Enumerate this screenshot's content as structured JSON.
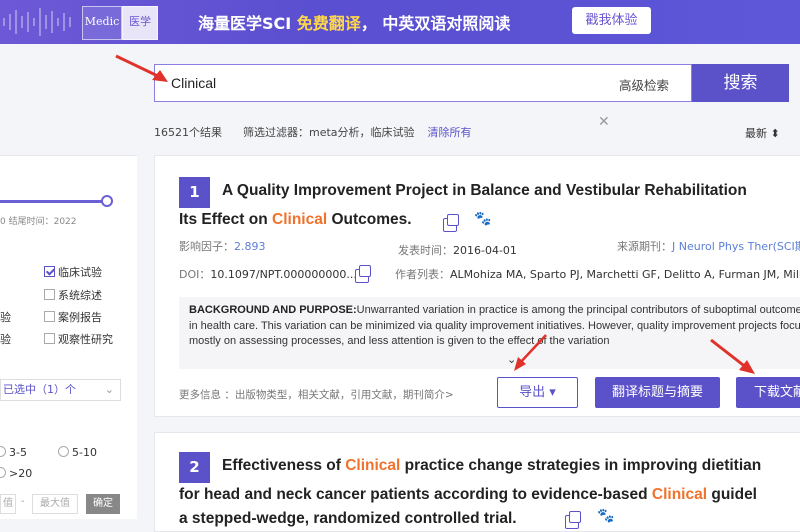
{
  "banner": {
    "logo_left": "Medic",
    "logo_right": "医学",
    "text_prefix": "海量医学SCI ",
    "text_highlight": "免费翻译",
    "text_suffix": "， 中英双语对照阅读",
    "button": "戳我体验"
  },
  "search": {
    "value": "Clinical",
    "advanced_label": "高级检索",
    "button_label": "搜索"
  },
  "results": {
    "count": "16521个结果",
    "filter_label": "筛选过滤器：meta分析，临床试验",
    "clear_label": "清除所有",
    "sort_label": "最新"
  },
  "sidebar": {
    "year_text": "0 结尾时间：2022",
    "checkboxes": [
      {
        "label": "临床试验",
        "checked": true
      },
      {
        "label": "系统综述",
        "checked": false
      },
      {
        "label": "验",
        "checked": false
      },
      {
        "label": "案例报告",
        "checked": false
      },
      {
        "label": "验",
        "checked": false
      },
      {
        "label": "观察性研究",
        "checked": false
      }
    ],
    "select_label": "已选中（1）个",
    "radios": [
      "3-5",
      "5-10",
      ">20"
    ],
    "min_label": "值",
    "max_label": "最大值",
    "confirm_label": "确定",
    "dash": "-"
  },
  "cards": [
    {
      "number": "1",
      "title_line1": "A Quality Improvement Project in Balance and Vestibular Rehabilitation",
      "title_line2_pre": "Its Effect on ",
      "title_line2_kw": "Clinical",
      "title_line2_post": " Outcomes.",
      "impact_label": "影响因子：",
      "impact_value": "2.893",
      "publish_label": "发表时间：",
      "publish_value": "2016-04-01",
      "source_label": "来源期刊：",
      "source_value": "J Neurol Phys Ther(SCI期",
      "doi_label": "DOI：",
      "doi_value": "10.1097/NPT.000000000...",
      "authors_label": "作者列表：",
      "authors_value": "ALMohiza MA, Sparto PJ, Marchetti GF, Delitto A, Furman JM, Mill",
      "abstract_head": "BACKGROUND AND PURPOSE:",
      "abstract_body": "Unwarranted variation in practice is among the principal contributors of suboptimal outcomes in health care. This variation can be minimized via quality improvement initiatives. However, quality improvement projects focus mostly on assessing processes, and less attention is given to the effect of the variation",
      "more_info": "更多信息 ：出版物类型，相关文献，引用文献，期刊简介>",
      "export_label": "导出 ▾",
      "translate_label": "翻译标题与摘要",
      "download_label": "下载文献"
    },
    {
      "number": "2",
      "title_line1_pre": "Effectiveness of ",
      "title_line1_kw": "Clinical",
      "title_line1_post": " practice change strategies in improving dietitian",
      "title_line2_pre": "for head and neck cancer patients according to evidence-based ",
      "title_line2_kw": "Clinical",
      "title_line2_post": " guidel",
      "title_line3": "a stepped-wedge, randomized controlled trial."
    }
  ],
  "colors": {
    "accent": "#5b52c9",
    "keyword": "#f0722c",
    "arrow": "#e0322a"
  }
}
